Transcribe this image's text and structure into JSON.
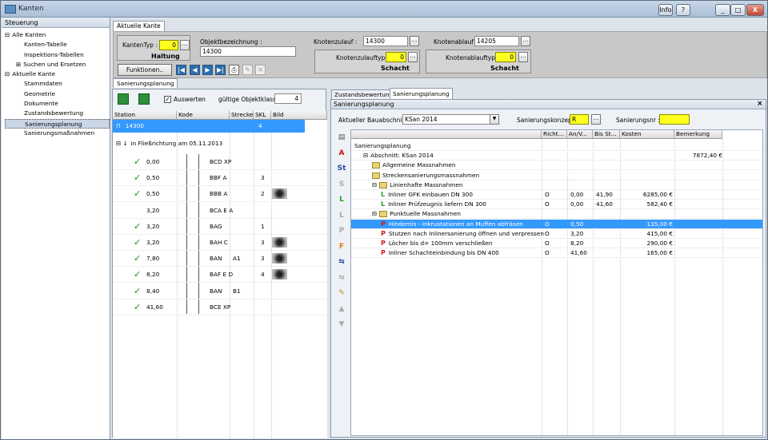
{
  "window": {
    "title": "Kanten",
    "info_label": "Info",
    "help_label": "?",
    "min_label": "_",
    "max_label": "□",
    "close_label": "X"
  },
  "sidebar": {
    "header": "Steuerung",
    "items": [
      {
        "label": "Alle Kanten",
        "indent": 0,
        "expander": "⊟"
      },
      {
        "label": "Kanten-Tabelle",
        "indent": 1
      },
      {
        "label": "Inspektions-Tabellen",
        "indent": 1
      },
      {
        "label": "Suchen und Ersetzen",
        "indent": 1,
        "expander": "⊞"
      },
      {
        "label": "Aktuelle Kante",
        "indent": 0,
        "expander": "⊟"
      },
      {
        "label": "Stammdaten",
        "indent": 1
      },
      {
        "label": "Geometrie",
        "indent": 1
      },
      {
        "label": "Dokumente",
        "indent": 1
      },
      {
        "label": "Zustandsbewertung",
        "indent": 1
      },
      {
        "label": "Sanierungsplanung",
        "indent": 1,
        "selected": true
      },
      {
        "label": "Sanierungsmaßnahmen",
        "indent": 1
      }
    ]
  },
  "top_tab": "Aktuelle Kante",
  "form": {
    "kantentyp_label": "KantenTyp :",
    "kantentyp_value": "0",
    "kantentyp_name": "Haltung",
    "objekt_label": "Objektbezeichnung :",
    "objekt_value": "14300",
    "zulauf_label": "Knotenzulauf :",
    "zulauf_value": "14300",
    "ablauf_label": "Knotenablauf :",
    "ablauf_value": "14205",
    "zulauftyp_label": "Knotenzulauftyp :",
    "zulauftyp_value": "0",
    "zulauftyp_name": "Schacht",
    "ablauftyp_label": "Knotenablauftyp :",
    "ablauftyp_value": "0",
    "ablauftyp_name": "Schacht",
    "funktionen_label": "Funktionen..",
    "dots": "..."
  },
  "subtab": "Sanierungsplanung",
  "left_panel": {
    "auswerten_label": "Auswerten",
    "klasse_label": "gültige Objektklasse :",
    "klasse_value": "4",
    "headers": [
      "Station",
      "Kode",
      "Strecke",
      "SKL",
      "Bild"
    ],
    "top_row": {
      "name": "14300",
      "skl": "4"
    },
    "group_label": "in Fließrichtung am 05.11.2013",
    "rows": [
      {
        "station": "0,00",
        "kode": "BCD XP",
        "strecke": "",
        "skl": "",
        "bild": false,
        "check": true
      },
      {
        "station": "0,50",
        "kode": "BBF A",
        "strecke": "",
        "skl": "3",
        "bild": false,
        "check": true
      },
      {
        "station": "0,50",
        "kode": "BBB A",
        "strecke": "",
        "skl": "2",
        "bild": true,
        "check": true
      },
      {
        "station": "3,20",
        "kode": "BCA E A",
        "strecke": "",
        "skl": "",
        "bild": false,
        "check": false
      },
      {
        "station": "3,20",
        "kode": "BAG",
        "strecke": "",
        "skl": "1",
        "bild": false,
        "check": true
      },
      {
        "station": "3,20",
        "kode": "BAH C",
        "strecke": "",
        "skl": "3",
        "bild": true,
        "check": true
      },
      {
        "station": "7,80",
        "kode": "BAN",
        "strecke": "A1",
        "skl": "3",
        "bild": true,
        "check": true
      },
      {
        "station": "8,20",
        "kode": "BAF E D",
        "strecke": "",
        "skl": "4",
        "bild": true,
        "check": true
      },
      {
        "station": "8,40",
        "kode": "BAN",
        "strecke": "B1",
        "skl": "",
        "bild": false,
        "check": true
      },
      {
        "station": "41,60",
        "kode": "BCE XP",
        "strecke": "",
        "skl": "",
        "bild": false,
        "check": true
      }
    ]
  },
  "right_tabs": [
    "Zustandsbewertung",
    "Sanierungsplanung"
  ],
  "right_panel": {
    "title": "Sanierungsplanung",
    "close_label": "×",
    "abschnitt_label": "Aktueller Bauabschnitt:",
    "abschnitt_value": "KSan 2014",
    "konzept_label": "Sanierungskonzept :",
    "konzept_value": "R",
    "nr_label": "Sanierungsnr :",
    "nr_value": "",
    "headers": [
      "",
      "Richt...",
      "An/V...",
      "Bis St...",
      "Kosten",
      "Bemerkung"
    ],
    "rows": [
      {
        "type": "root",
        "text": "Sanierungsplanung",
        "indent": 0
      },
      {
        "type": "abschnitt",
        "text": "Abschnitt: KSan 2014",
        "indent": 1,
        "bem": "7872,40 €",
        "exp": "⊟"
      },
      {
        "type": "folder",
        "text": "Allgemeine Massnahmen",
        "indent": 2
      },
      {
        "type": "folder",
        "text": "Streckensanierungsmassnahmen",
        "indent": 2
      },
      {
        "type": "folder",
        "text": "Linienhafte Massnahmen",
        "indent": 2,
        "exp": "⊟"
      },
      {
        "type": "L",
        "text": "Inliner GFK einbauen DN 300",
        "indent": 3,
        "richt": "O",
        "an": "0,00",
        "bis": "41,90",
        "kosten": "6285,00 €"
      },
      {
        "type": "L",
        "text": "Inliner Prüfzeugnis liefern DN 300",
        "indent": 3,
        "richt": "O",
        "an": "0,00",
        "bis": "41,60",
        "kosten": "582,40 €"
      },
      {
        "type": "folder",
        "text": "Punktuelle Massnahmen",
        "indent": 2,
        "exp": "⊟"
      },
      {
        "type": "P",
        "text": "Hindernis - Inkrustationen an Muffen abfräsen",
        "indent": 3,
        "richt": "O",
        "an": "0,50",
        "bis": "",
        "kosten": "135,00 €",
        "selected": true
      },
      {
        "type": "P",
        "text": "Stutzen nach Inlinersanierung öffnen und verpressen",
        "indent": 3,
        "richt": "O",
        "an": "3,20",
        "bis": "",
        "kosten": "415,00 €"
      },
      {
        "type": "P",
        "text": "Löcher bis d= 100mm verschließen",
        "indent": 3,
        "richt": "O",
        "an": "8,20",
        "bis": "",
        "kosten": "290,00 €"
      },
      {
        "type": "P",
        "text": "Inliner Schachteinbindung bis DN 400",
        "indent": 3,
        "richt": "O",
        "an": "41,60",
        "bis": "",
        "kosten": "165,00 €"
      }
    ],
    "tool_icons": [
      {
        "name": "sanierung-icon",
        "glyph": "▤",
        "color": "#555"
      },
      {
        "name": "add-abschnitt-icon",
        "glyph": "A",
        "color": "#c01818"
      },
      {
        "name": "add-strecke-icon",
        "glyph": "St",
        "color": "#1b4ea0"
      },
      {
        "name": "strecke-gray-icon",
        "glyph": "S",
        "color": "#aaa"
      },
      {
        "name": "add-linie-icon",
        "glyph": "L",
        "color": "#22a222"
      },
      {
        "name": "linie-gray-icon",
        "glyph": "L",
        "color": "#aaa"
      },
      {
        "name": "punkt-gray-icon",
        "glyph": "P",
        "color": "#aaa"
      },
      {
        "name": "add-f-icon",
        "glyph": "F",
        "color": "#e07a10"
      },
      {
        "name": "sort-icon",
        "glyph": "⇆",
        "color": "#1b4ea0"
      },
      {
        "name": "sort-gray-icon",
        "glyph": "⇆",
        "color": "#aaa"
      },
      {
        "name": "edit-icon",
        "glyph": "✎",
        "color": "#b08a10"
      },
      {
        "name": "arrow-up-icon",
        "glyph": "▲",
        "color": "#aaa"
      },
      {
        "name": "arrow-down-icon",
        "glyph": "▼",
        "color": "#aaa"
      }
    ]
  },
  "colors": {
    "selection": "#3399ff",
    "yellow_field": "#ffff20"
  }
}
